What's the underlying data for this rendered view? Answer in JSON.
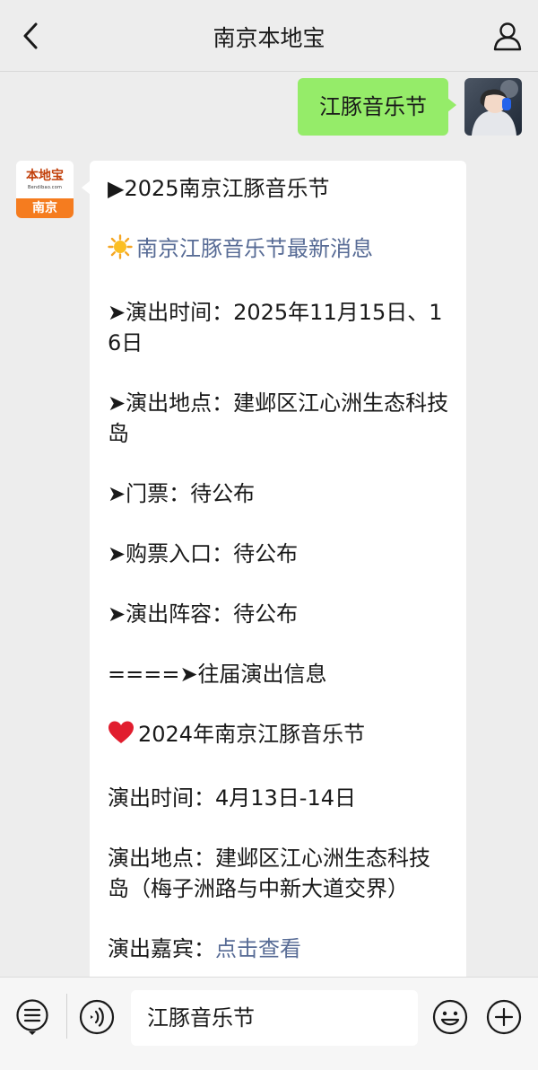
{
  "header": {
    "title": "南京本地宝",
    "back_icon": "chevron-left-icon",
    "profile_icon": "person-icon"
  },
  "chat": {
    "outgoing": {
      "text": "江豚音乐节"
    },
    "incoming": {
      "avatar": {
        "logo_text": "本地宝",
        "logo_sub": "Bendibao.com",
        "city": "南京"
      },
      "lines": [
        "▶2025南京江豚音乐节",
        "南京江豚音乐节最新消息",
        "➤演出时间：2025年11月15日、16日",
        "➤演出地点：建邺区江心洲生态科技岛",
        "➤门票：待公布",
        "➤购票入口：待公布",
        "➤演出阵容：待公布",
        "====➤往届演出信息",
        "2024年南京江豚音乐节",
        "演出时间：4月13日-14日",
        "演出地点：建邺区江心洲生态科技岛（梅子洲路与中新大道交界）",
        "演出嘉宾：",
        "点击查看"
      ]
    }
  },
  "bottombar": {
    "menu_icon": "menu-list-icon",
    "voice_icon": "voice-icon",
    "input_value": "江豚音乐节",
    "emoji_icon": "emoji-icon",
    "add_icon": "plus-icon"
  },
  "colors": {
    "background": "#ededed",
    "outgoing_bubble": "#95ec69",
    "link": "#576b95",
    "logo_orange": "#f57c1f"
  }
}
